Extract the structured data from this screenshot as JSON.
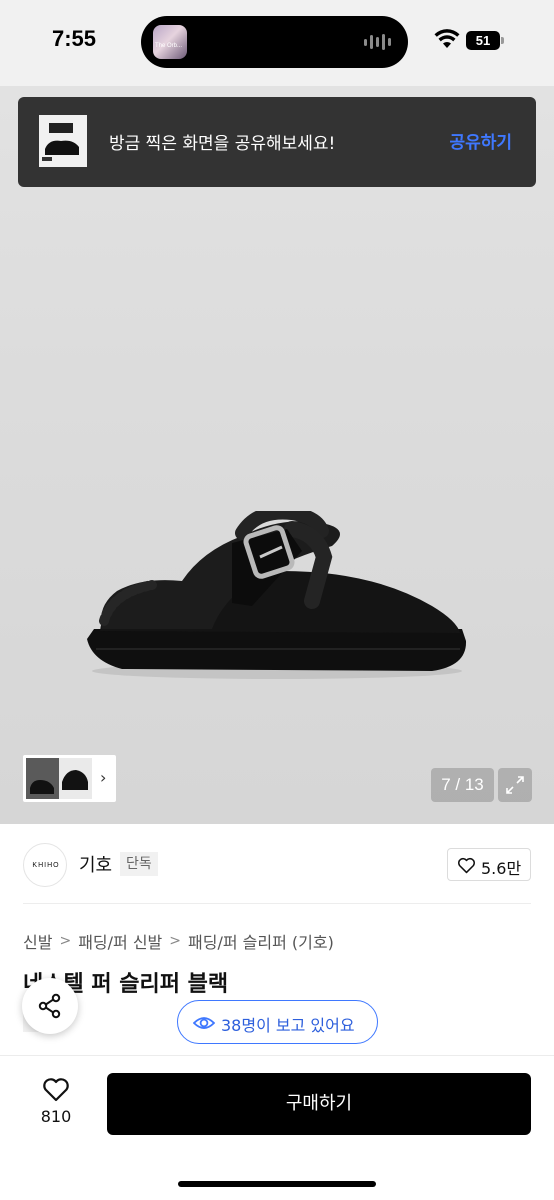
{
  "status_bar": {
    "time": "7:55",
    "battery_level": "51",
    "now_playing_art_text": "The Orb...",
    "icons": [
      "wifi-icon",
      "battery-icon",
      "audio-wave-icon"
    ]
  },
  "toast": {
    "message": "방금 찍은 화면을 공유해보세요!",
    "action_label": "공유하기"
  },
  "gallery": {
    "counter": "7 / 13",
    "current_index": 7,
    "total": 13
  },
  "brand": {
    "logo_text": "KHIHO",
    "name": "기호",
    "badge": "단독",
    "likes": "5.6만"
  },
  "breadcrumb": {
    "items": [
      "신발",
      "패딩/퍼 신발",
      "패딩/퍼 슬리퍼 (기호)"
    ]
  },
  "product": {
    "title": "네스텔 퍼 슬리퍼 블랙",
    "exclusive_tag": "단독",
    "viewers_text": "38명이 보고 있어요"
  },
  "bottom_bar": {
    "wish_count": "810",
    "buy_label": "구매하기"
  },
  "colors": {
    "accent_blue": "#3f78ff",
    "toast_bg": "#333333",
    "buy_button_bg": "#000000"
  }
}
